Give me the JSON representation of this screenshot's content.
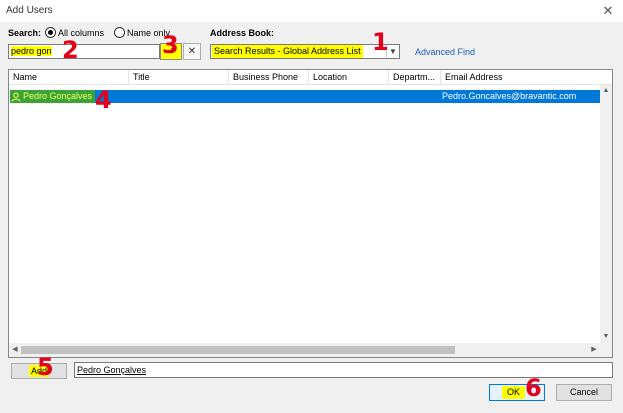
{
  "window": {
    "title": "Add Users"
  },
  "search": {
    "label": "Search:",
    "option_all": "All columns",
    "option_name": "Name only",
    "value": "pedro gon",
    "go_glyph": "➔",
    "clear_glyph": "✕"
  },
  "address_book": {
    "label": "Address Book:",
    "selected": "Search Results - Global Address List",
    "advanced_find": "Advanced Find"
  },
  "table": {
    "columns": [
      "Name",
      "Title",
      "Business Phone",
      "Location",
      "Departm...",
      "Email Address"
    ],
    "rows": [
      {
        "name": "Pedro Gonçalves",
        "email": "Pedro.Goncalves@bravantic.com"
      }
    ]
  },
  "footer": {
    "add_label": "Add",
    "added_value": "Pedro Gonçalves",
    "ok_label": "OK",
    "cancel_label": "Cancel"
  },
  "annotations": [
    "1",
    "2",
    "3",
    "4",
    "5",
    "6"
  ],
  "colors": {
    "highlight": "#ffff00",
    "selection": "#0078d7",
    "annotation": "#e2001a",
    "contact_highlight": "#3aa536"
  }
}
